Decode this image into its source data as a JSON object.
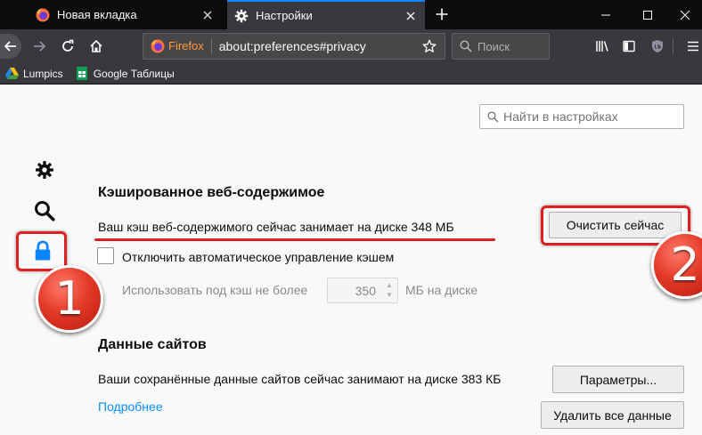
{
  "tabs": [
    {
      "title": "Новая вкладка",
      "icon": "firefox-icon",
      "active": false
    },
    {
      "title": "Настройки",
      "icon": "gear-icon",
      "active": true
    }
  ],
  "navbar": {
    "identity_label": "Firefox",
    "url": "about:preferences#privacy",
    "search_placeholder": "Поиск"
  },
  "bookmarks": [
    {
      "label": "Lumpics",
      "icon": "google-drive-icon"
    },
    {
      "label": "Google Таблицы",
      "icon": "google-sheets-icon"
    }
  ],
  "preferences": {
    "find_placeholder": "Найти в настройках",
    "cache": {
      "title": "Кэшированное веб-содержимое",
      "usage_text": "Ваш кэш веб-содержимого сейчас занимает на диске 348 МБ",
      "clear_button": "Очистить сейчас",
      "override_label": "Отключить автоматическое управление кэшем",
      "override_checked": false,
      "limit_label": "Использовать под кэш не более",
      "limit_value": "350",
      "limit_unit": "МБ на диске"
    },
    "site_data": {
      "title": "Данные сайтов",
      "usage_text": "Ваши сохранённые данные сайтов сейчас занимают на диске 383 КБ",
      "learn_more": "Подробнее",
      "settings_button": "Параметры...",
      "clear_all_button": "Удалить все данные"
    }
  },
  "annotations": {
    "badge_1": "1",
    "badge_2": "2",
    "highlight_color": "#e02020"
  },
  "colors": {
    "accent": "#0a84ff",
    "link": "#0a8dff",
    "titlebar": "#0c0c0d",
    "toolbar": "#38383d"
  }
}
